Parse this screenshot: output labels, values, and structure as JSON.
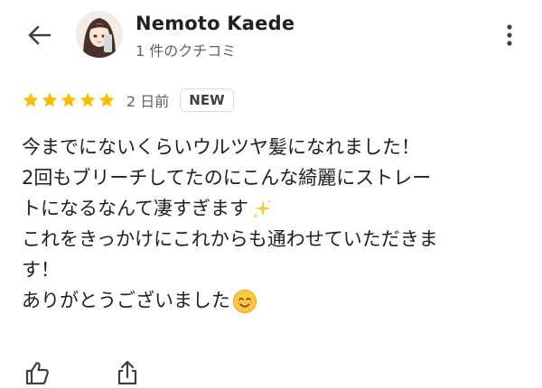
{
  "header": {
    "back_icon": "arrow-left-icon",
    "author_name": "Nemoto Kaede",
    "author_meta": "1 件のクチコミ",
    "more_icon": "more-vertical-icon"
  },
  "review": {
    "rating": 5,
    "rating_max": 5,
    "star_color": "#fbbc04",
    "date": "2 日前",
    "badge": "NEW",
    "lines": [
      "今までにないくらいウルツヤ髪になれました！",
      "2回もブリーチしてたのにこんな綺麗にストレー",
      "トになるなんて凄すぎます",
      "これをきっかけにこれからも通わせていただきま",
      "す！",
      "ありがとうございました"
    ],
    "line3_emoji": "sparkles-emoji",
    "line6_emoji": "smiling-face-emoji"
  },
  "actions": {
    "like_icon": "thumbs-up-icon",
    "share_icon": "share-icon"
  }
}
